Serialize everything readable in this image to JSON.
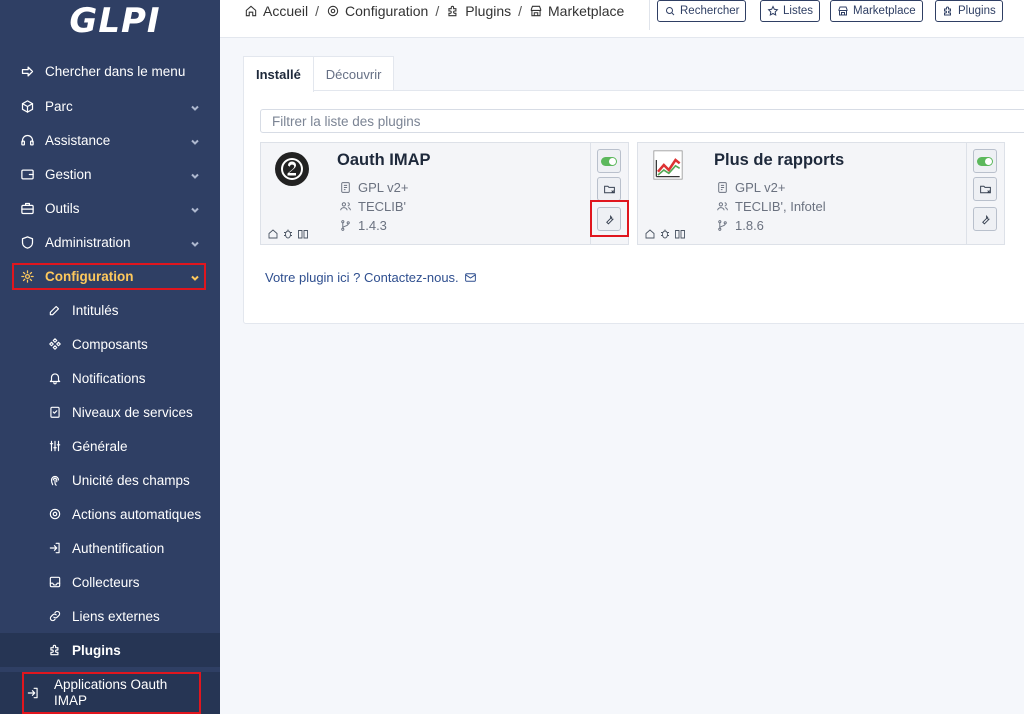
{
  "app": {
    "logo_text": "GLPI"
  },
  "sidebar": {
    "items": [
      {
        "label": "Chercher dans le menu",
        "icon": "arrow-right-icon"
      },
      {
        "label": "Parc",
        "icon": "box-icon"
      },
      {
        "label": "Assistance",
        "icon": "headset-icon"
      },
      {
        "label": "Gestion",
        "icon": "wallet-icon"
      },
      {
        "label": "Outils",
        "icon": "briefcase-icon"
      },
      {
        "label": "Administration",
        "icon": "shield-icon"
      },
      {
        "label": "Configuration",
        "icon": "gear-icon"
      }
    ],
    "config_sub": [
      {
        "label": "Intitulés",
        "icon": "edit-icon"
      },
      {
        "label": "Composants",
        "icon": "components-icon"
      },
      {
        "label": "Notifications",
        "icon": "bell-icon"
      },
      {
        "label": "Niveaux de services",
        "icon": "checklist-icon"
      },
      {
        "label": "Générale",
        "icon": "sliders-icon"
      },
      {
        "label": "Unicité des champs",
        "icon": "fingerprint-icon"
      },
      {
        "label": "Actions automatiques",
        "icon": "cog-icon"
      },
      {
        "label": "Authentification",
        "icon": "login-icon"
      },
      {
        "label": "Collecteurs",
        "icon": "inbox-icon"
      },
      {
        "label": "Liens externes",
        "icon": "link-icon"
      },
      {
        "label": "Plugins",
        "icon": "puzzle-icon"
      },
      {
        "label": "Applications Oauth IMAP",
        "icon": "login-arrow-icon"
      }
    ]
  },
  "header": {
    "breadcrumbs": [
      "Accueil",
      "Configuration",
      "Plugins",
      "Marketplace"
    ],
    "buttons": [
      "Rechercher",
      "Listes",
      "Marketplace",
      "Plugins"
    ]
  },
  "tabs": [
    "Installé",
    "Découvrir"
  ],
  "filter": {
    "placeholder": "Filtrer la liste des plugins"
  },
  "plugins": [
    {
      "name": "Oauth IMAP",
      "license": "GPL v2+",
      "authors": "TECLIB'",
      "version": "1.4.3",
      "enabled": true
    },
    {
      "name": "Plus de rapports",
      "license": "GPL v2+",
      "authors": "TECLIB', Infotel",
      "version": "1.8.6",
      "enabled": true
    }
  ],
  "contact": {
    "text": "Votre plugin ici ? Contactez-nous."
  },
  "colors": {
    "sidebar": "#2f3f64",
    "active": "#fec95c",
    "highlight": "#e0161e",
    "toggle": "#5cb85c"
  }
}
